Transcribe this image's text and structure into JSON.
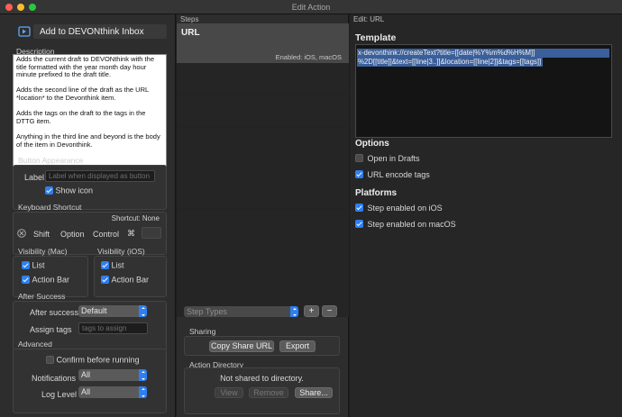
{
  "window": {
    "title": "Edit Action"
  },
  "action": {
    "name": "Add to DEVONthink Inbox",
    "description_label": "Description",
    "description": "Adds the current draft to DEVONthink with the title formatted with the year month day hour minute prefixed to the draft title.\n\nAdds the second line of the draft as the URL *location* to the Devonthink item.\n\nAdds the tags on the draft to the tags in the DTTG item.\n\nAnything in the third line and beyond is the body of the item in Devonthink."
  },
  "button_appearance": {
    "section": "Button Appearance",
    "label_caption": "Label",
    "label_placeholder": "Label when displayed as button",
    "show_icon": "Show icon"
  },
  "keyboard_shortcut": {
    "section": "Keyboard Shortcut",
    "shortcut_status": "Shortcut: None",
    "shift": "Shift",
    "option": "Option",
    "control": "Control",
    "command": "⌘"
  },
  "visibility_mac": {
    "section": "Visibility (Mac)",
    "list": "List",
    "action_bar": "Action Bar"
  },
  "visibility_ios": {
    "section": "Visibility (iOS)",
    "list": "List",
    "action_bar": "Action Bar"
  },
  "after_success": {
    "section": "After Success",
    "after_success_label": "After success",
    "after_success_value": "Default",
    "assign_tags_label": "Assign tags",
    "assign_tags_placeholder": "tags to assign"
  },
  "advanced": {
    "section": "Advanced",
    "confirm": "Confirm before running",
    "notifications_label": "Notifications",
    "notifications_value": "All",
    "log_level_label": "Log Level",
    "log_level_value": "All"
  },
  "steps": {
    "header": "Steps",
    "items": [
      {
        "name": "URL",
        "enabled": "Enabled: iOS, macOS"
      }
    ],
    "step_types": "Step Types",
    "add": "+",
    "remove": "−"
  },
  "sharing": {
    "section": "Sharing",
    "copy_share_url": "Copy Share URL",
    "export": "Export"
  },
  "action_directory": {
    "section": "Action Directory",
    "status": "Not shared to directory.",
    "view": "View",
    "remove": "Remove",
    "share": "Share..."
  },
  "editor": {
    "header": "Edit: URL",
    "template_label": "Template",
    "template_line1": "x-devonthink://createText?title=[[date|%Y%m%d%H%M]]",
    "template_line2": "%2D[[title]]&text=[[line|3..]]&location=[[line|2]]&tags=[[tags]]",
    "options_label": "Options",
    "open_in_drafts": "Open in Drafts",
    "url_encode_tags": "URL encode tags",
    "platforms_label": "Platforms",
    "step_ios": "Step enabled on iOS",
    "step_macos": "Step enabled on macOS"
  },
  "colors": {
    "accent": "#2f7ff0",
    "selection": "#3a5f9a",
    "panel": "#2d2d2d"
  }
}
